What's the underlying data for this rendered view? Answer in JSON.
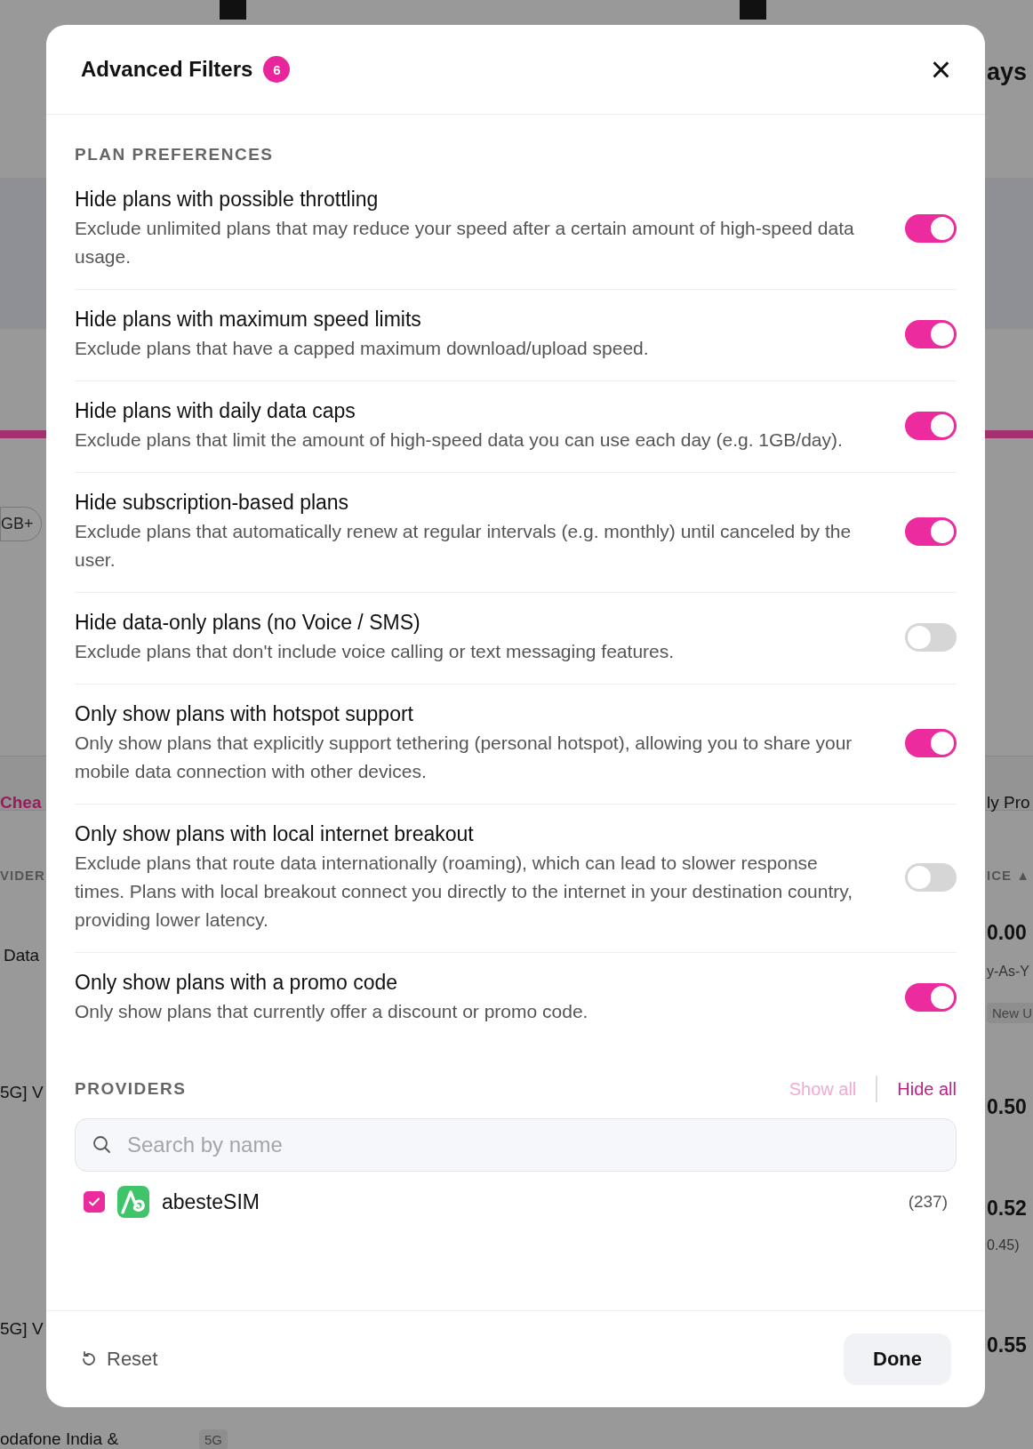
{
  "background": {
    "left": [
      {
        "text": "GB+",
        "kind": "chip"
      },
      {
        "text": "Chea",
        "kind": "tab"
      },
      {
        "text": "VIDER",
        "kind": "heading"
      },
      {
        "text": "Data",
        "kind": "cell"
      },
      {
        "text": "5G] V",
        "kind": "cell"
      },
      {
        "text": "5G] V",
        "kind": "cell"
      },
      {
        "text": "odafone India &",
        "kind": "cell"
      },
      {
        "text": "5G",
        "kind": "tag"
      }
    ],
    "right": [
      {
        "text": "ays",
        "kind": "title"
      },
      {
        "text": "ly Pro",
        "kind": "cell"
      },
      {
        "text": "ICE ▲",
        "kind": "heading"
      },
      {
        "text": "0.00",
        "kind": "price"
      },
      {
        "text": "y-As-Y",
        "kind": "note"
      },
      {
        "text": "New U",
        "kind": "tag"
      },
      {
        "text": "0.50",
        "kind": "price"
      },
      {
        "text": "0.52",
        "kind": "price"
      },
      {
        "text": "0.45)",
        "kind": "note"
      },
      {
        "text": "0.55",
        "kind": "price"
      }
    ]
  },
  "dialog": {
    "title": "Advanced Filters",
    "badge": "6",
    "close": "×",
    "section": "PLAN PREFERENCES",
    "filters": [
      {
        "title": "Hide plans with possible throttling",
        "description": "Exclude unlimited plans that may reduce your speed after a certain amount of high-speed data usage.",
        "on": true
      },
      {
        "title": "Hide plans with maximum speed limits",
        "description": "Exclude plans that have a capped maximum download/upload speed.",
        "on": true
      },
      {
        "title": "Hide plans with daily data caps",
        "description": "Exclude plans that limit the amount of high-speed data you can use each day (e.g. 1GB/day).",
        "on": true
      },
      {
        "title": "Hide subscription-based plans",
        "description": "Exclude plans that automatically renew at regular intervals (e.g. monthly) until canceled by the user.",
        "on": true
      },
      {
        "title": "Hide data-only plans (no Voice / SMS)",
        "description": "Exclude plans that don't include voice calling or text messaging features.",
        "on": false
      },
      {
        "title": "Only show plans with hotspot support",
        "description": "Only show plans that explicitly support tethering (personal hotspot), allowing you to share your mobile data connection with other devices.",
        "on": true
      },
      {
        "title": "Only show plans with local internet breakout",
        "description": "Exclude plans that route data internationally (roaming), which can lead to slower response times. Plans with local breakout connect you directly to the internet in your destination country, providing lower latency.",
        "on": false
      },
      {
        "title": "Only show plans with a promo code",
        "description": "Only show plans that currently offer a discount or promo code.",
        "on": true
      }
    ],
    "providers_title": "PROVIDERS",
    "show_all": {
      "label": "Show all",
      "disabled": true
    },
    "hide_all": {
      "label": "Hide all",
      "disabled": false
    },
    "search": {
      "placeholder": "Search by name"
    },
    "providers": [
      {
        "name": "abesteSIM",
        "count": "(237)",
        "checked": true
      }
    ],
    "reset": "Reset",
    "done": "Done"
  }
}
